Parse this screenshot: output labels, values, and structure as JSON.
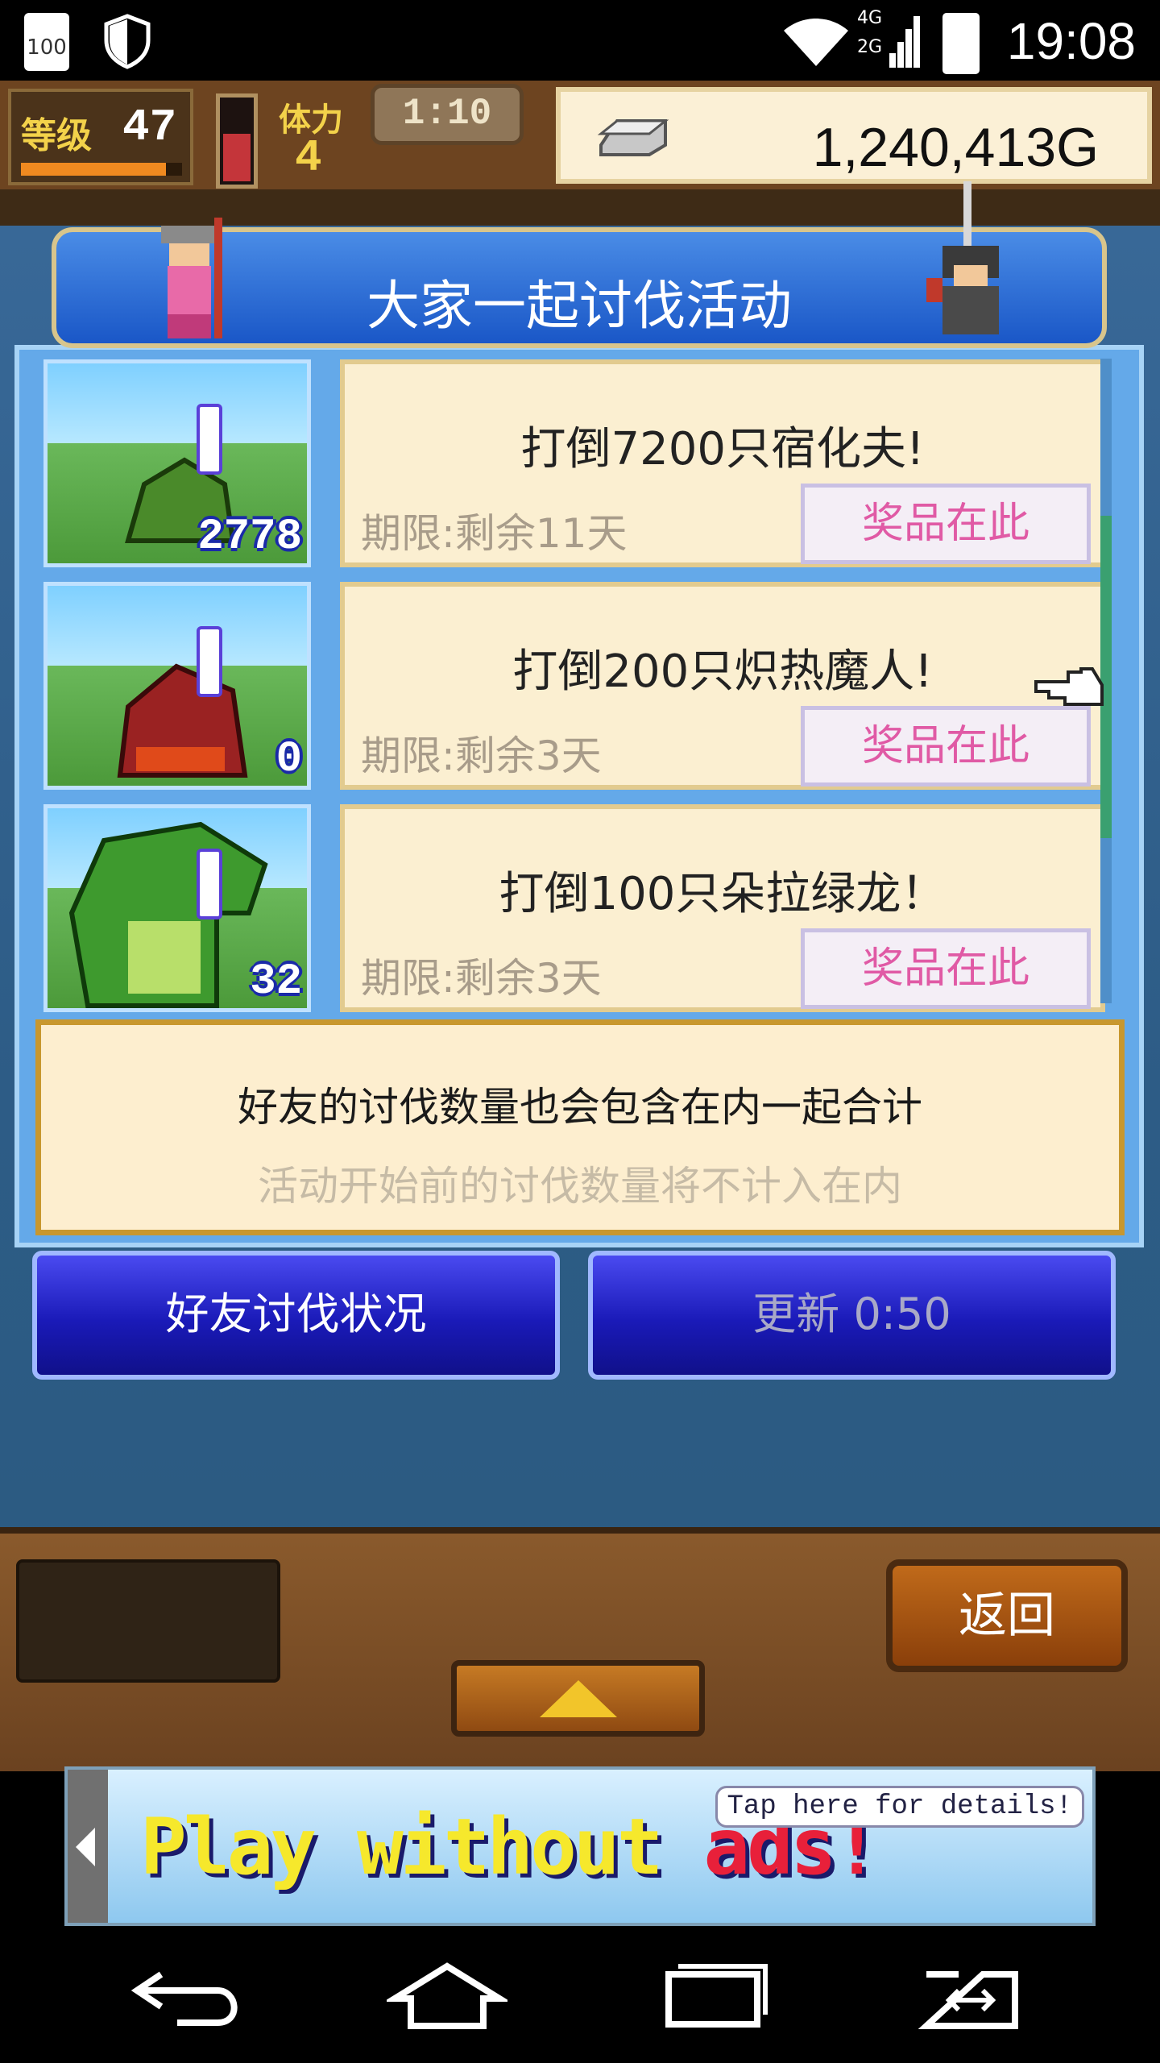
{
  "status_bar": {
    "time": "19:08",
    "battery": "100",
    "network_top": "4G",
    "network_bottom": "2G"
  },
  "hud": {
    "level_label": "等级",
    "level_value": "47",
    "level_progress": 0.9,
    "stamina_label": "体力",
    "stamina_value": "4",
    "timer": "1:10",
    "money": "1,240,413G"
  },
  "dialog": {
    "title": "大家一起讨伐活动",
    "quests": [
      {
        "title": "打倒7200只宿化夫!",
        "deadline": "期限:剩余11天",
        "prize_button": "奖品在此",
        "count": "2778",
        "monster_color": "#4a8a2a"
      },
      {
        "title": "打倒200只炽热魔人!",
        "deadline": "期限:剩余3天",
        "prize_button": "奖品在此",
        "count": "0",
        "monster_color": "#9a2222"
      },
      {
        "title": "打倒100只朵拉绿龙！",
        "deadline": "期限:剩余3天",
        "prize_button": "奖品在此",
        "count": "32",
        "monster_color": "#3e9a2e"
      }
    ],
    "info_line1": "好友的讨伐数量也会包含在内一起合计",
    "info_line2": "活动开始前的讨伐数量将不计入在内",
    "friend_status_button": "好友讨伐状况",
    "refresh_button": "更新 0:50"
  },
  "bottom": {
    "back_button": "返回"
  },
  "ad": {
    "text_yellow": "Play without ",
    "text_red": "ads!",
    "tap": "Tap here for details!"
  },
  "colors": {
    "dialog_blue": "#64a9e9",
    "title_blue": "#1a57c7",
    "prize_pink": "#e05aa5"
  }
}
